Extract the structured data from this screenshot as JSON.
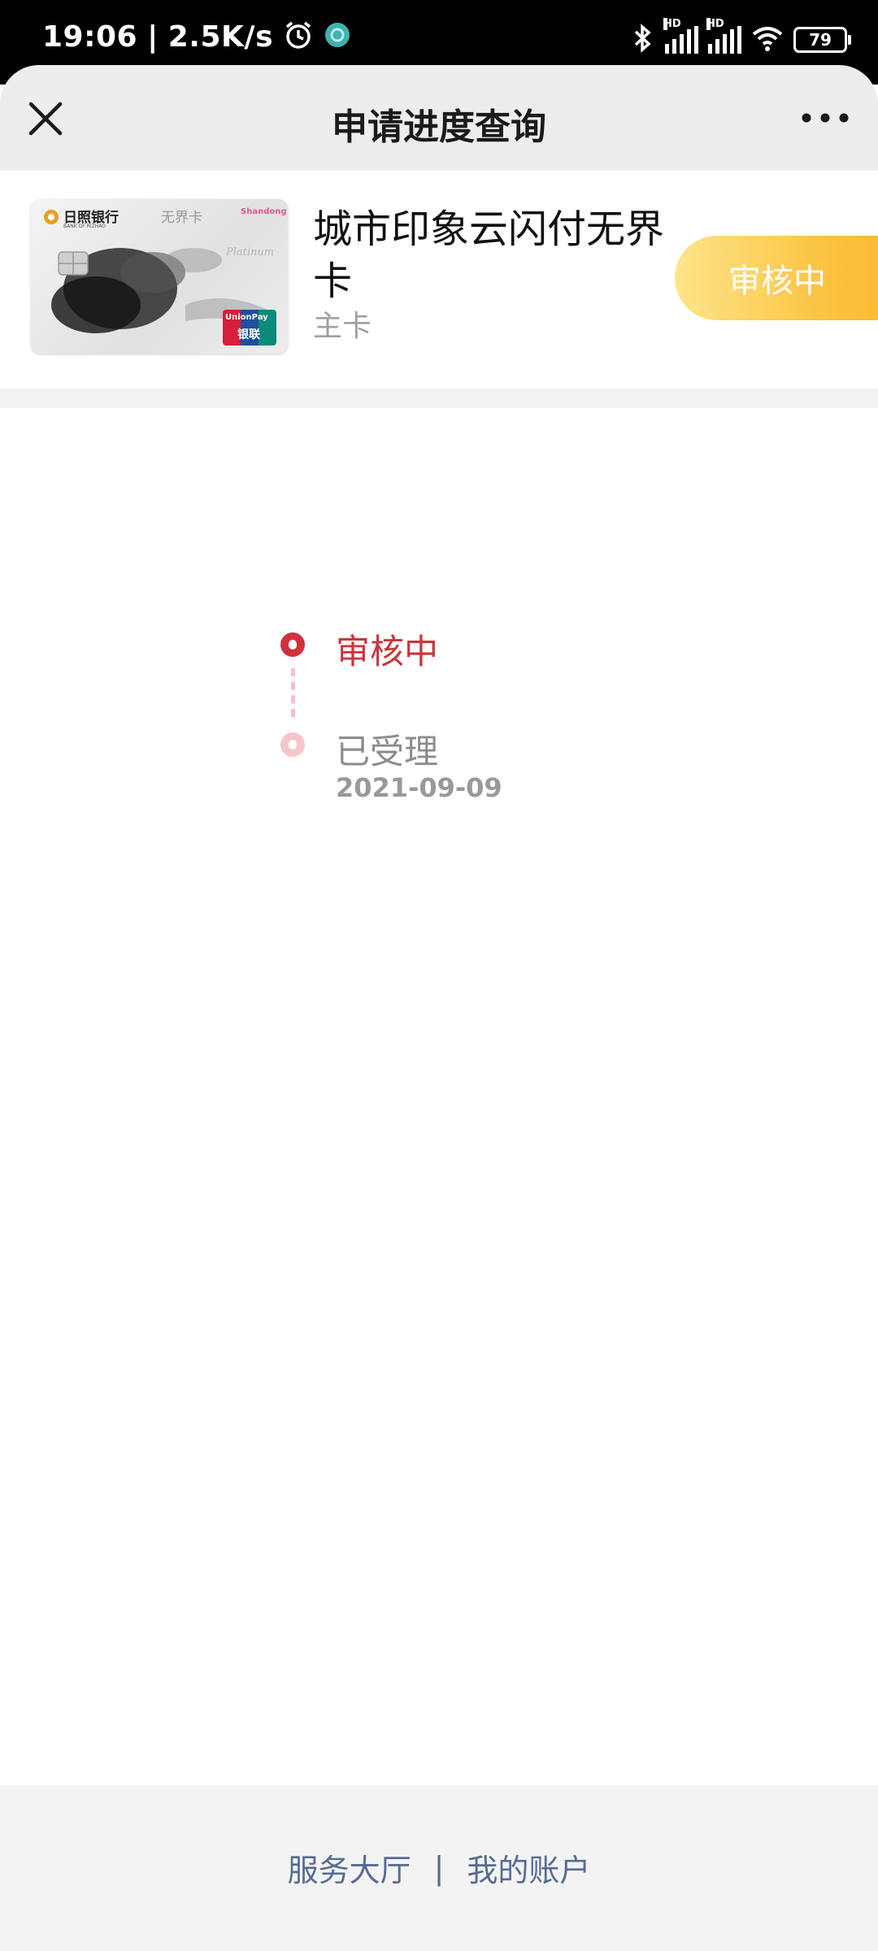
{
  "status_bar": {
    "time": "19:06",
    "net_speed": "2.5K/s",
    "battery": "79",
    "signal_badge": "HD",
    "icons": [
      "alarm-icon",
      "app-notification-icon",
      "bluetooth-icon",
      "signal-icon",
      "wifi-icon",
      "battery-icon"
    ]
  },
  "header": {
    "title": "申请进度查询",
    "close_icon": "close-icon",
    "more_icon": "more-icon"
  },
  "card": {
    "name": "城市印象云闪付无界卡",
    "type": "主卡",
    "status": "审核中",
    "image_text": {
      "bank": "日照银行",
      "bank_en": "BANK OF RIZHAO",
      "product": "无界卡",
      "platinum": "Platinum",
      "unionpay": "UnionPay",
      "unionpay_cn": "银联",
      "brand": "Shandong"
    }
  },
  "timeline": [
    {
      "label": "审核中",
      "date": "",
      "state": "active"
    },
    {
      "label": "已受理",
      "date": "2021-09-09",
      "state": "done"
    }
  ],
  "footer": {
    "links": [
      "服务大厅",
      "我的账户"
    ],
    "separator": "|"
  },
  "colors": {
    "accent_red": "#d0323b",
    "status_gold": "#fbc23e",
    "link_blue": "#576b95"
  }
}
